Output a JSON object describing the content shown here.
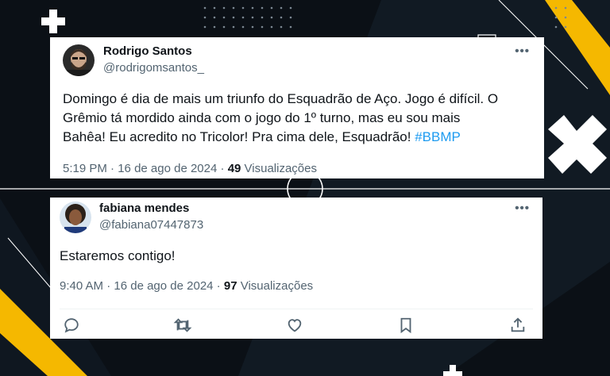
{
  "tweets": [
    {
      "author_name": "Rodrigo Santos",
      "author_handle": "@rodrigomsantos_",
      "more": "•••",
      "text_lines": [
        "Domingo é dia de mais um triunfo do Esquadrão de Aço. Jogo é difícil. O",
        "Grêmio tá mordido ainda com o jogo do 1º turno, mas eu sou mais",
        "Bahêa! Eu acredito no Tricolor! Pra cima dele, Esquadrão! "
      ],
      "hashtag": "#BBMP",
      "time": "5:19 PM",
      "date": "16 de ago de 2024",
      "views_count": "49",
      "views_label": "Visualizações"
    },
    {
      "author_name": "fabiana mendes",
      "author_handle": "@fabiana07447873",
      "more": "•••",
      "text": "Estaremos contigo!",
      "time": "9:40 AM",
      "date": "16 de ago de 2024",
      "views_count": "97",
      "views_label": "Visualizações",
      "actions": [
        "reply-icon",
        "retweet-icon",
        "like-icon",
        "bookmark-icon",
        "share-icon"
      ]
    }
  ],
  "colors": {
    "background": "#0b1016",
    "accent_yellow": "#f5b800",
    "link_blue": "#1d9bf0",
    "secondary_text": "#536471"
  }
}
